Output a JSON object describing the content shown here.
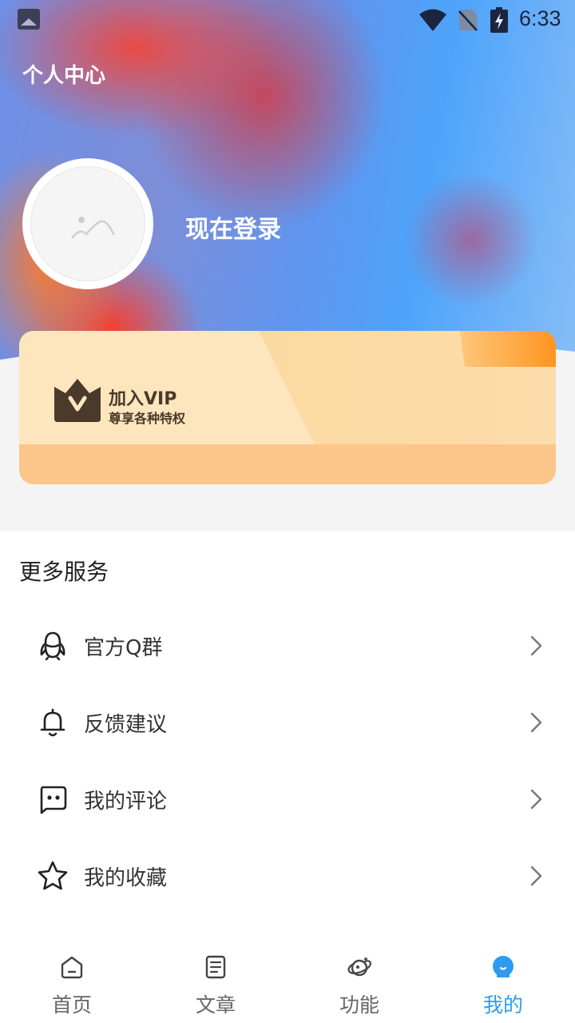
{
  "status_bar": {
    "time": "6:33"
  },
  "header": {
    "title": "个人中心"
  },
  "profile": {
    "login_text": "现在登录"
  },
  "vip": {
    "title": "加入VIP",
    "subtitle": "尊享各种特权"
  },
  "services": {
    "title": "更多服务",
    "items": [
      {
        "label": "官方Q群",
        "icon": "qq-icon"
      },
      {
        "label": "反馈建议",
        "icon": "bell-icon"
      },
      {
        "label": "我的评论",
        "icon": "comment-icon"
      },
      {
        "label": "我的收藏",
        "icon": "star-icon"
      }
    ]
  },
  "tabbar": {
    "items": [
      {
        "label": "首页",
        "icon": "home-icon"
      },
      {
        "label": "文章",
        "icon": "article-icon"
      },
      {
        "label": "功能",
        "icon": "planet-icon"
      },
      {
        "label": "我的",
        "icon": "profile-icon",
        "active": true
      }
    ]
  },
  "colors": {
    "accent": "#2d9cf0",
    "vip_dark": "#4a3a2c",
    "vip_light": "#fde6bd",
    "vip_bottom": "#fcc58a"
  }
}
